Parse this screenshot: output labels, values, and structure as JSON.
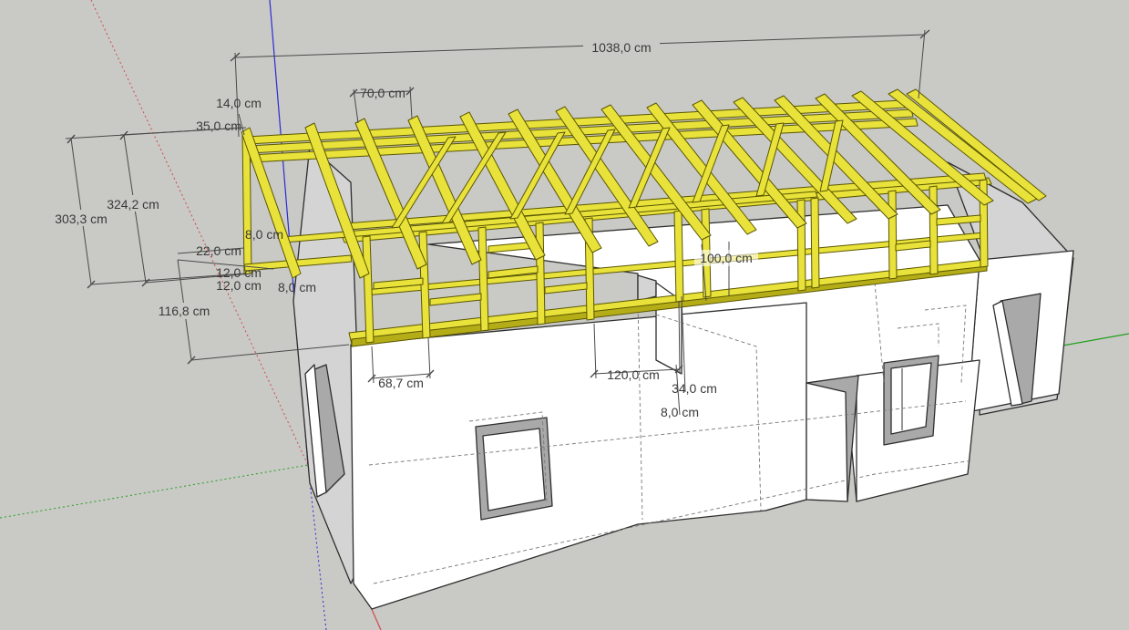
{
  "app": "SketchUp",
  "axes": {
    "blue": "#2b2bd6",
    "red": "#d24a4a",
    "green": "#1fa01f"
  },
  "colors": {
    "timber": "#e8e23a",
    "wall": "#ffffff",
    "background": "#c9c9c5"
  },
  "dimensions": {
    "total_length": "1038,0 cm",
    "rafter_spacing": "70,0 cm",
    "beam_14": "14,0 cm",
    "beam_35": "35,0 cm",
    "height_324": "324,2 cm",
    "height_303": "303,3 cm",
    "d_8_top": "8,0 cm",
    "d_22": "22,0 cm",
    "d_12_a": "12,0 cm",
    "d_12_b": "12,0 cm",
    "d_8_side": "8,0 cm",
    "height_116": "116,8 cm",
    "d_100": "100,0 cm",
    "d_68": "68,7 cm",
    "d_120": "120,0 cm",
    "d_34": "34,0 cm",
    "d_8_bottom": "8,0 cm"
  }
}
